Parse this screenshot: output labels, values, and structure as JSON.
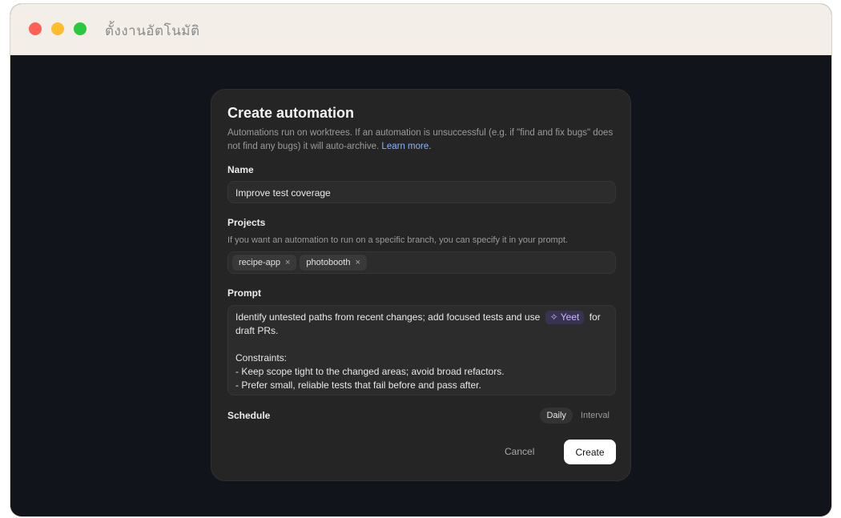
{
  "window": {
    "title": "ตั้งงานอัตโนมัติ"
  },
  "modal": {
    "title": "Create automation",
    "description": "Automations run on worktrees. If an automation is unsuccessful (e.g. if \"find and fix bugs\" does not find any bugs) it will auto-archive.",
    "learn_more": "Learn more.",
    "name": {
      "label": "Name",
      "value": "Improve test coverage"
    },
    "projects": {
      "label": "Projects",
      "hint": "If you want an automation to run on a specific branch, you can specify it in your prompt.",
      "chips": [
        "recipe-app",
        "photobooth"
      ],
      "remove_glyph": "×"
    },
    "prompt": {
      "label": "Prompt",
      "line1_before": "Identify untested paths from recent changes; add focused tests and use",
      "tag_glyph": "✧",
      "tag_label": "Yeet",
      "line1_after": "for",
      "line2": "draft PRs.",
      "line4": "Constraints:",
      "line5": "- Keep scope tight to the changed areas; avoid broad refactors.",
      "line6": "- Prefer small, reliable tests that fail before and pass after."
    },
    "schedule": {
      "label": "Schedule",
      "options": [
        "Daily",
        "Interval"
      ],
      "selected": "Daily"
    },
    "actions": {
      "cancel": "Cancel",
      "create": "Create"
    }
  },
  "colors": {
    "background": "#11141b",
    "modal": "#252525",
    "link": "#8ab4f8",
    "tag": "#c6b6ff"
  }
}
